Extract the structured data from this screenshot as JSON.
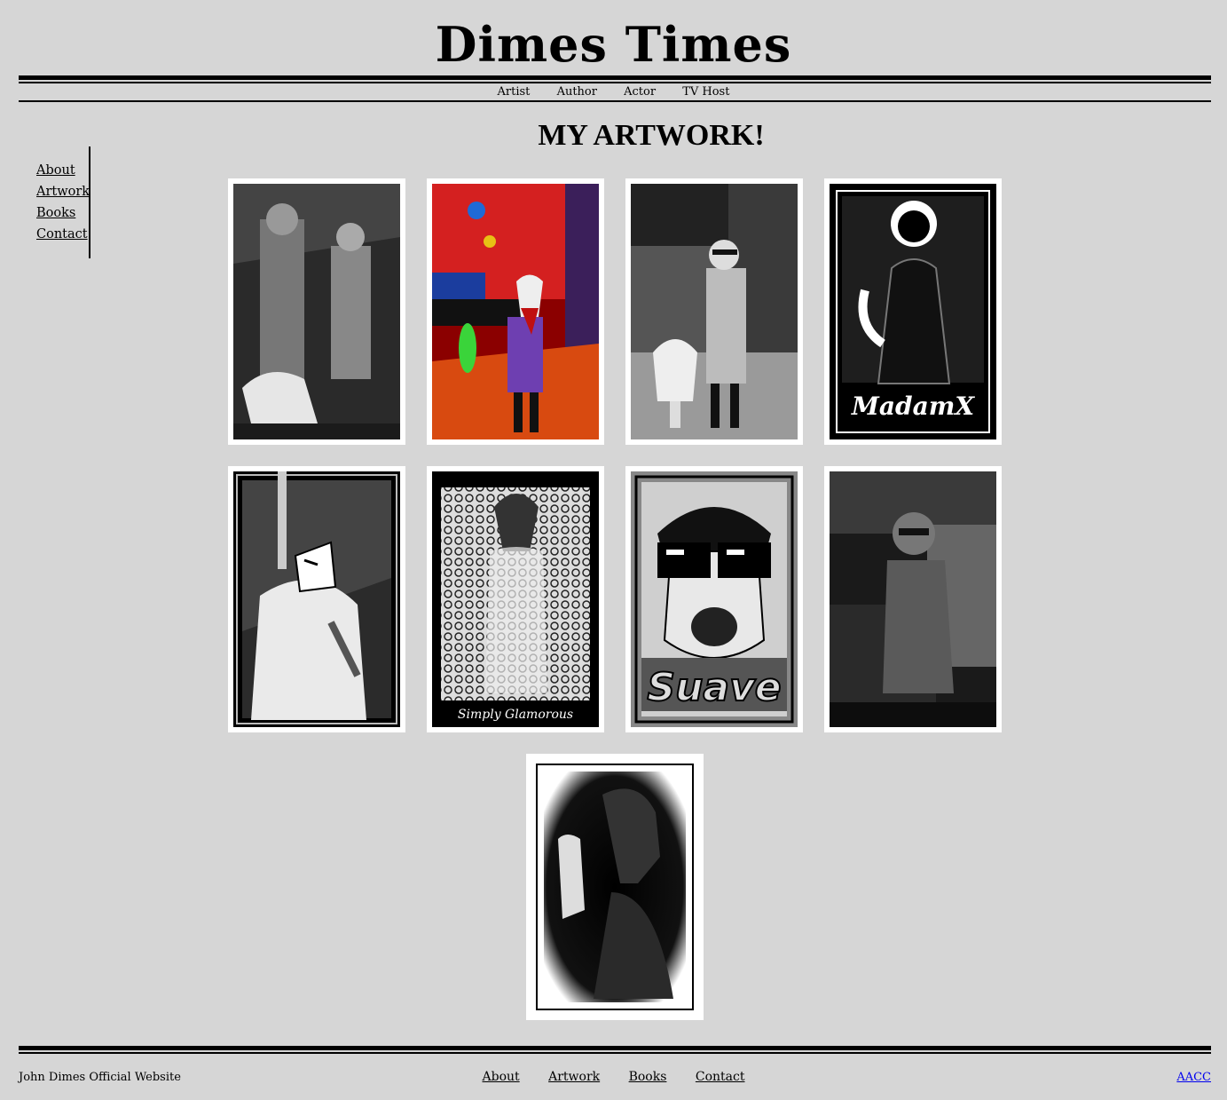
{
  "site": {
    "title": "Dimes Times"
  },
  "top_nav": [
    "Artist",
    "Author",
    "Actor",
    "TV Host"
  ],
  "page_title": "MY ARTWORK!",
  "side_nav": [
    "About",
    "Artwork",
    "Books",
    "Contact"
  ],
  "artworks": [
    {
      "caption": ""
    },
    {
      "caption": ""
    },
    {
      "caption": ""
    },
    {
      "caption": "MadamX"
    },
    {
      "caption": ""
    },
    {
      "caption": "Simply Glamorous"
    },
    {
      "caption": "Suave"
    },
    {
      "caption": ""
    },
    {
      "caption": ""
    }
  ],
  "footer": {
    "site_text": "John Dimes Official Website",
    "nav": [
      "About",
      "Artwork",
      "Books",
      "Contact"
    ],
    "link": "AACC"
  },
  "colors": {
    "background": "#d6d6d6",
    "text": "#000000",
    "link": "#0000ee",
    "frame": "#ffffff"
  }
}
